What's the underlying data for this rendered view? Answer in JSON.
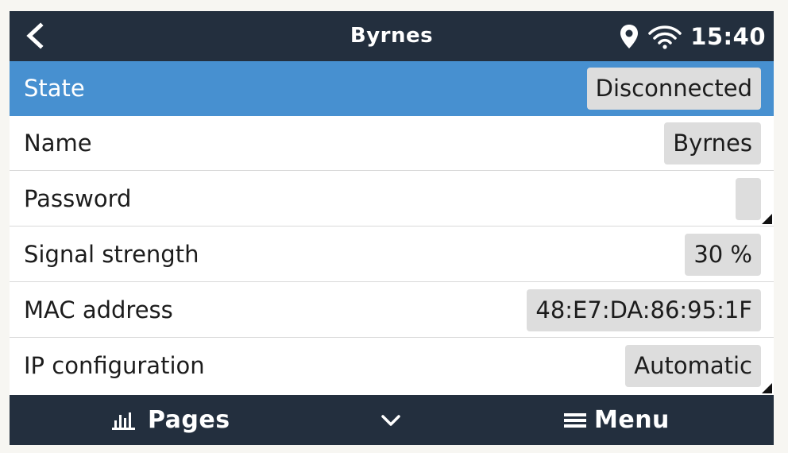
{
  "header": {
    "title": "Byrnes",
    "back_icon": "chevron-left-icon",
    "location_icon": "location-pin-icon",
    "wifi_icon": "wifi-icon",
    "time": "15:40"
  },
  "settings": {
    "rows": [
      {
        "label": "State",
        "value": "Disconnected",
        "selected": true
      },
      {
        "label": "Name",
        "value": "Byrnes"
      },
      {
        "label": "Password",
        "value": ""
      },
      {
        "label": "Signal strength",
        "value": "30 %"
      },
      {
        "label": "MAC address",
        "value": "48:E7:DA:86:95:1F"
      },
      {
        "label": "IP configuration",
        "value": "Automatic"
      }
    ]
  },
  "footer": {
    "pages_label": "Pages",
    "pages_icon": "bar-chart-icon",
    "scroll_icon": "chevron-down-icon",
    "menu_label": "Menu",
    "menu_icon": "hamburger-icon"
  },
  "colors": {
    "header_bg": "#232f3e",
    "selected_row": "#4790d0",
    "value_box": "#dddddd"
  }
}
